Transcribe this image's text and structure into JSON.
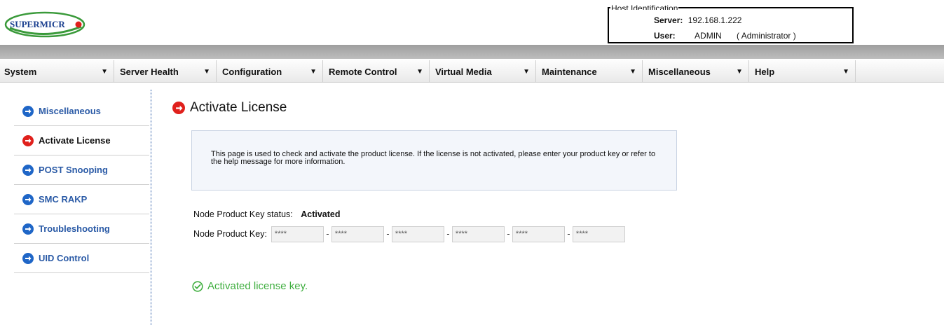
{
  "header": {
    "logo_text": "SUPERMICRO",
    "host_identification": {
      "legend": "Host Identification",
      "server_label": "Server:",
      "server_value": "192.168.1.222",
      "user_label": "User:",
      "user_value": "ADMIN",
      "user_role": "( Administrator )"
    }
  },
  "menu": [
    {
      "label": "System"
    },
    {
      "label": "Server Health"
    },
    {
      "label": "Configuration"
    },
    {
      "label": "Remote Control"
    },
    {
      "label": "Virtual Media"
    },
    {
      "label": "Maintenance"
    },
    {
      "label": "Miscellaneous"
    },
    {
      "label": "Help"
    }
  ],
  "sidebar": {
    "items": [
      {
        "label": "Miscellaneous",
        "icon": "arrow-right-blue-icon",
        "active": false
      },
      {
        "label": "Activate License",
        "icon": "arrow-right-red-icon",
        "active": true
      },
      {
        "label": "POST Snooping",
        "icon": "arrow-right-blue-icon",
        "active": false
      },
      {
        "label": "SMC RAKP",
        "icon": "arrow-right-blue-icon",
        "active": false
      },
      {
        "label": "Troubleshooting",
        "icon": "arrow-right-blue-icon",
        "active": false
      },
      {
        "label": "UID Control",
        "icon": "arrow-right-blue-icon",
        "active": false
      }
    ]
  },
  "main": {
    "title": "Activate License",
    "info_text": "This page is used to check and activate the product license. If the license is not activated, please enter your product key or refer to the help message for more information.",
    "status_label": "Node Product Key status:",
    "status_value": "Activated",
    "key_label": "Node Product Key:",
    "key_fields": [
      "****",
      "****",
      "****",
      "****",
      "****",
      "****"
    ],
    "key_separator": "-",
    "success_message": "Activated license key."
  },
  "colors": {
    "accent_blue": "#1f66c7",
    "accent_red": "#e0201c",
    "success_green": "#3fae3f"
  }
}
